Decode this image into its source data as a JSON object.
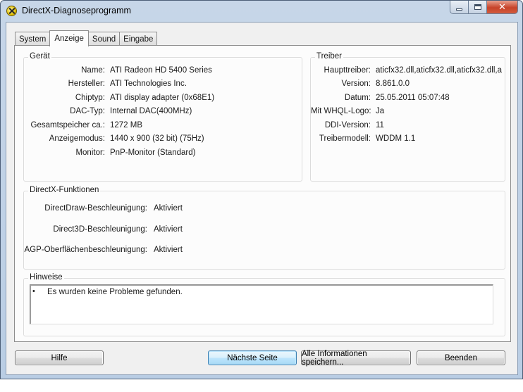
{
  "window": {
    "title": "DirectX-Diagnoseprogramm",
    "app_icon": "directx-icon",
    "caption": {
      "close_label": "✕"
    }
  },
  "tabs": [
    {
      "label": "System",
      "active": false
    },
    {
      "label": "Anzeige",
      "active": true
    },
    {
      "label": "Sound",
      "active": false
    },
    {
      "label": "Eingabe",
      "active": false
    }
  ],
  "device": {
    "title": "Gerät",
    "rows": [
      {
        "label": "Name:",
        "value": "ATI Radeon HD 5400 Series"
      },
      {
        "label": "Hersteller:",
        "value": "ATI Technologies Inc."
      },
      {
        "label": "Chiptyp:",
        "value": "ATI display adapter (0x68E1)"
      },
      {
        "label": "DAC-Typ:",
        "value": "Internal DAC(400MHz)"
      },
      {
        "label": "Gesamtspeicher ca.:",
        "value": "1272 MB"
      },
      {
        "label": "Anzeigemodus:",
        "value": "1440 x 900 (32 bit) (75Hz)"
      },
      {
        "label": "Monitor:",
        "value": "PnP-Monitor (Standard)"
      }
    ]
  },
  "drivers": {
    "title": "Treiber",
    "rows": [
      {
        "label": "Haupttreiber:",
        "value": "aticfx32.dll,aticfx32.dll,aticfx32.dll,a"
      },
      {
        "label": "Version:",
        "value": "8.861.0.0"
      },
      {
        "label": "Datum:",
        "value": "25.05.2011 05:07:48"
      },
      {
        "label": "Mit WHQL-Logo:",
        "value": "Ja"
      },
      {
        "label": "DDI-Version:",
        "value": "11"
      },
      {
        "label": "Treibermodell:",
        "value": "WDDM 1.1"
      }
    ]
  },
  "features": {
    "title": "DirectX-Funktionen",
    "rows": [
      {
        "label": "DirectDraw-Beschleunigung:",
        "value": "Aktiviert"
      },
      {
        "label": "Direct3D-Beschleunigung:",
        "value": "Aktiviert"
      },
      {
        "label": "AGP-Oberflächenbeschleunigung:",
        "value": "Aktiviert"
      }
    ]
  },
  "notes": {
    "title": "Hinweise",
    "bullet": "•",
    "items": [
      "Es wurden keine Probleme gefunden."
    ]
  },
  "buttons": {
    "help": "Hilfe",
    "next": "Nächste Seite",
    "save_all": "Alle Informationen speichern...",
    "exit": "Beenden"
  }
}
